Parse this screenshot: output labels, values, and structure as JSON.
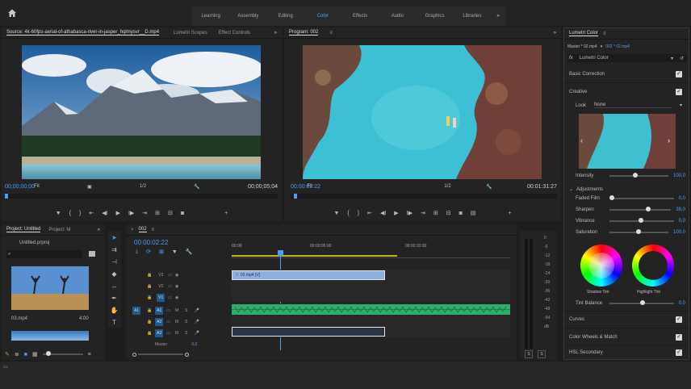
{
  "workspace": {
    "tabs": [
      "Learning",
      "Assembly",
      "Editing",
      "Color",
      "Effects",
      "Audio",
      "Graphics",
      "Libraries"
    ],
    "active": "Color",
    "more": "»"
  },
  "source": {
    "tabs": [
      "Source: 4k-60fps-aerial-of-athabasca-river-in-jasper_hqlmysvr__D.mp4",
      "Lumetri Scopes",
      "Effect Controls"
    ],
    "timecode": "00;00;00;00",
    "fit": "Fit",
    "fraction": "1/2",
    "duration": "00;00;05;04"
  },
  "program": {
    "title": "Program: 002",
    "timecode": "00:00:02:22",
    "fit": "Fit",
    "fraction": "1/2",
    "duration": "00:01:31:27"
  },
  "project": {
    "tabs": [
      "Project: Untitled",
      "Project: M"
    ],
    "file": "Untitled.prproj",
    "thumb_name": "03.mp4",
    "thumb_duration": "4:00"
  },
  "timeline": {
    "sequence": "002",
    "timecode": "00:00:02:22",
    "ruler": [
      "00:00",
      "00:00:05:00",
      "00:00:10:00"
    ],
    "video_tracks": [
      "V3",
      "V2",
      "V1"
    ],
    "audio_tracks": [
      "A1",
      "A2",
      "A3"
    ],
    "source_patch": "A1",
    "master": "Master",
    "master_value": "0,0",
    "clip_label": "02.mp4 [V]",
    "fx": "fx",
    "m": "M",
    "s": "S"
  },
  "meters": {
    "scale": [
      "0",
      "-6",
      "-12",
      "-18",
      "-24",
      "-30",
      "-36",
      "-42",
      "-48",
      "-54",
      "dB"
    ],
    "bottom": [
      "S",
      "S"
    ]
  },
  "lumetri": {
    "title": "Lumetri Color",
    "master_label": "Master * 02.mp4",
    "seq_label": "002 * 02.mp4",
    "fx": "fx",
    "effect_name": "Lumetri Color",
    "basic": "Basic Correction",
    "creative": "Creative",
    "look_label": "Look",
    "look_value": "None",
    "intensity_label": "Intensity",
    "intensity_value": "100,0",
    "adjustments": "Adjustments",
    "rows": [
      {
        "label": "Faded Film",
        "value": "0,0",
        "pos": 0.0
      },
      {
        "label": "Sharpen",
        "value": "39,0",
        "pos": 0.65
      },
      {
        "label": "Vibrance",
        "value": "0,0",
        "pos": 0.5
      },
      {
        "label": "Saturation",
        "value": "100,0",
        "pos": 0.5
      }
    ],
    "shadow_tint": "Shadow Tint",
    "highlight_tint": "Highlight Tint",
    "tint_balance_label": "Tint Balance",
    "tint_balance_value": "0,0",
    "curves": "Curves",
    "color_wheels": "Color Wheels & Match",
    "hsl": "HSL Secondary"
  },
  "colors": {
    "accent": "#4a9ff5",
    "audio_clip": "#2fae6b",
    "video_clip": "#8fb0df",
    "bg": "#232323"
  }
}
